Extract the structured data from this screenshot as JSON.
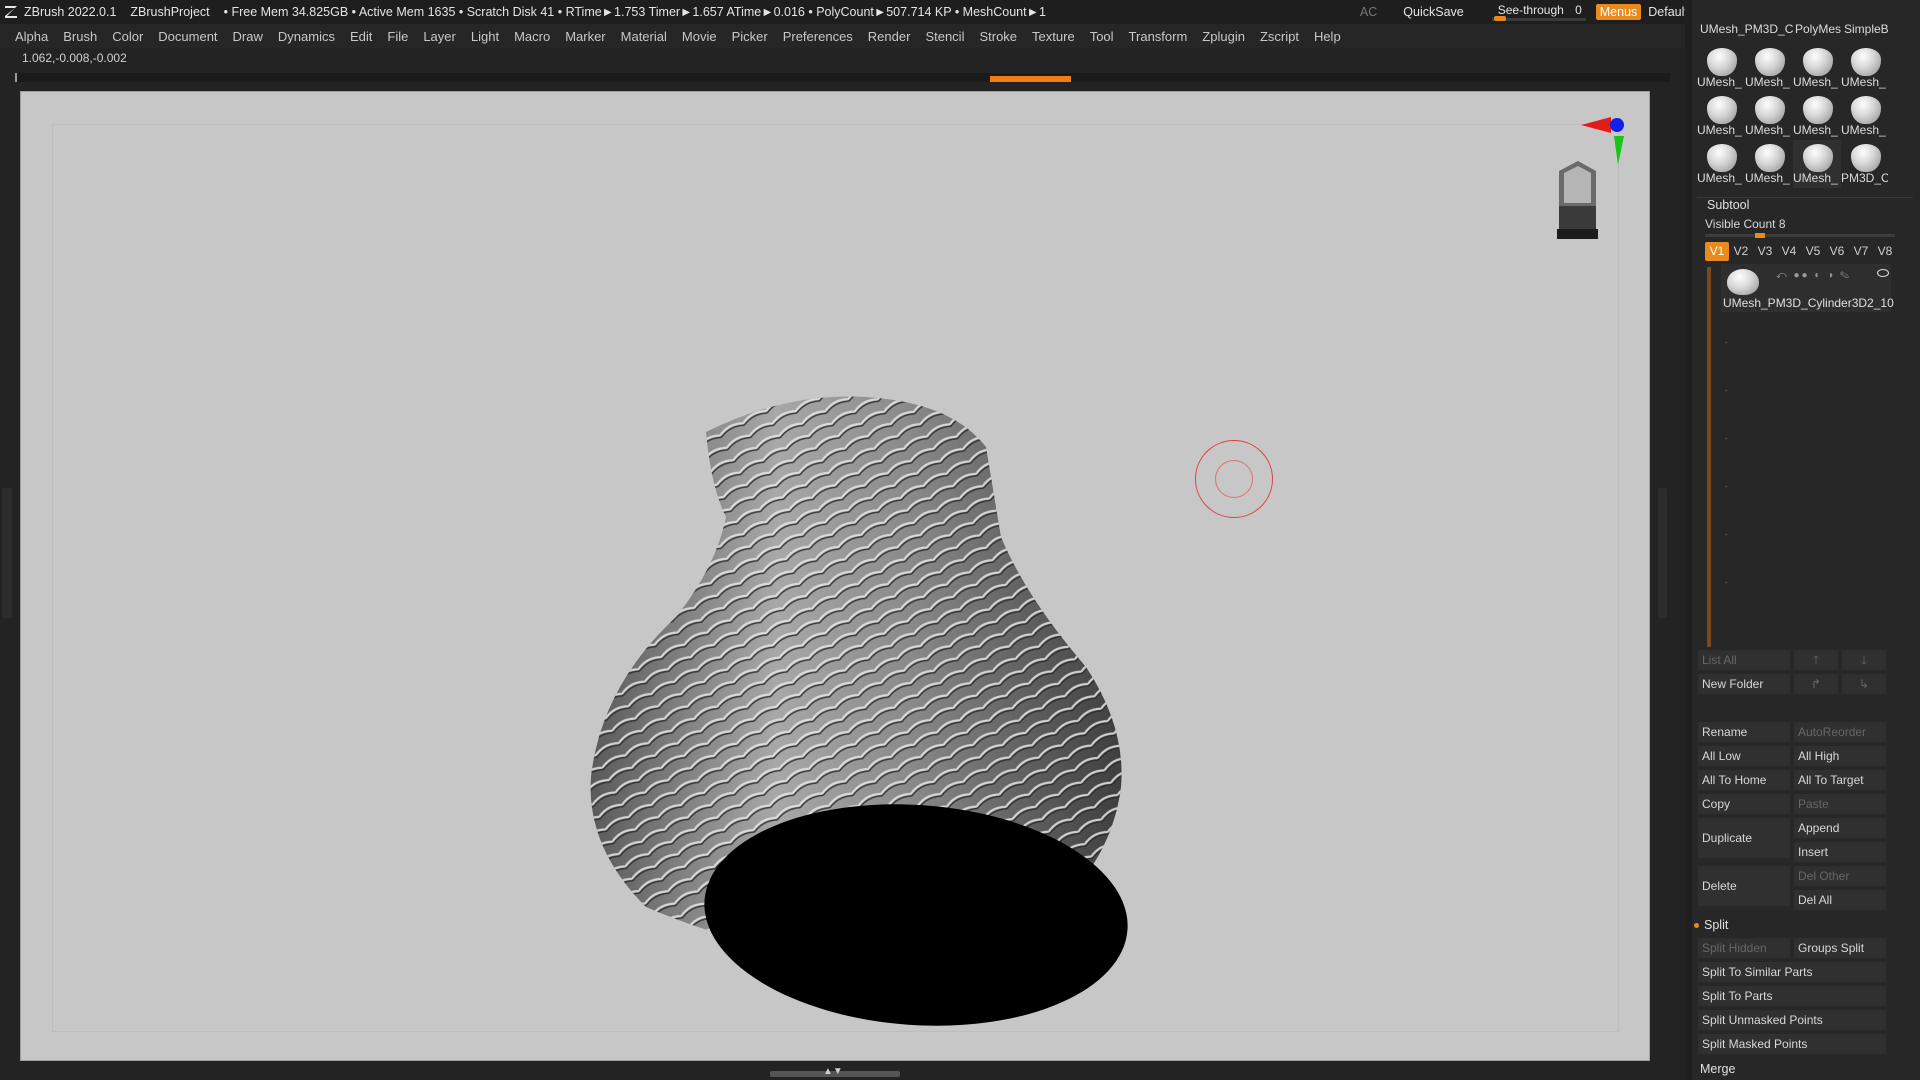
{
  "titlebar": {
    "app": "ZBrush 2022.0.1",
    "project": "ZBrushProject",
    "stats": "• Free Mem 34.825GB • Active Mem 1635 • Scratch Disk 41 • RTime►1.753 Timer►1.657 ATime►0.016 • PolyCount►507.714 KP • MeshCount►1",
    "ac": "AC",
    "quicksave": "QuickSave",
    "seethrough_label": "See-through",
    "seethrough_value": "0",
    "seethrough_level": 0,
    "menus": "Menus",
    "script": "DefaultZScript"
  },
  "menu": [
    "Alpha",
    "Brush",
    "Color",
    "Document",
    "Draw",
    "Dynamics",
    "Edit",
    "File",
    "Layer",
    "Light",
    "Macro",
    "Marker",
    "Material",
    "Movie",
    "Picker",
    "Preferences",
    "Render",
    "Stencil",
    "Stroke",
    "Texture",
    "Tool",
    "Transform",
    "Zplugin",
    "Zscript",
    "Help"
  ],
  "coords": "1.062,-0.008,-0.002",
  "colors": {
    "accent": "#e98a1e",
    "viewport_bg": "#c7c7c7",
    "panel_bg": "#272727"
  },
  "tool_palette": {
    "header": [
      "UMesh_PM3D_C",
      "PolyMes",
      "SimpleB"
    ],
    "rows": [
      [
        "UMesh_",
        "UMesh_",
        "UMesh_",
        "UMesh_"
      ],
      [
        "UMesh_",
        "UMesh_",
        "UMesh_",
        "UMesh_"
      ],
      [
        "UMesh_",
        "UMesh_",
        "UMesh_",
        "PM3D_C"
      ]
    ]
  },
  "subtool": {
    "title": "Subtool",
    "visible_count": "Visible Count 8",
    "tabs": [
      "V1",
      "V2",
      "V3",
      "V4",
      "V5",
      "V6",
      "V7",
      "V8"
    ],
    "active_tab": "V1",
    "item_name": "UMesh_PM3D_Cylinder3D2_10",
    "list_all": "List All",
    "new_folder": "New Folder",
    "rename": "Rename",
    "autoreorder": "AutoReorder",
    "all_low": "All Low",
    "all_high": "All High",
    "all_to_home": "All To Home",
    "all_to_target": "All To Target",
    "copy": "Copy",
    "paste": "Paste",
    "duplicate": "Duplicate",
    "append": "Append",
    "insert": "Insert",
    "delete": "Delete",
    "del_other": "Del Other",
    "del_all": "Del All",
    "split_section": "Split",
    "split_hidden": "Split Hidden",
    "groups_split": "Groups Split",
    "split_similar": "Split To Similar Parts",
    "split_parts": "Split To Parts",
    "split_unmasked": "Split Unmasked Points",
    "split_masked": "Split Masked Points",
    "merge_section": "Merge"
  }
}
